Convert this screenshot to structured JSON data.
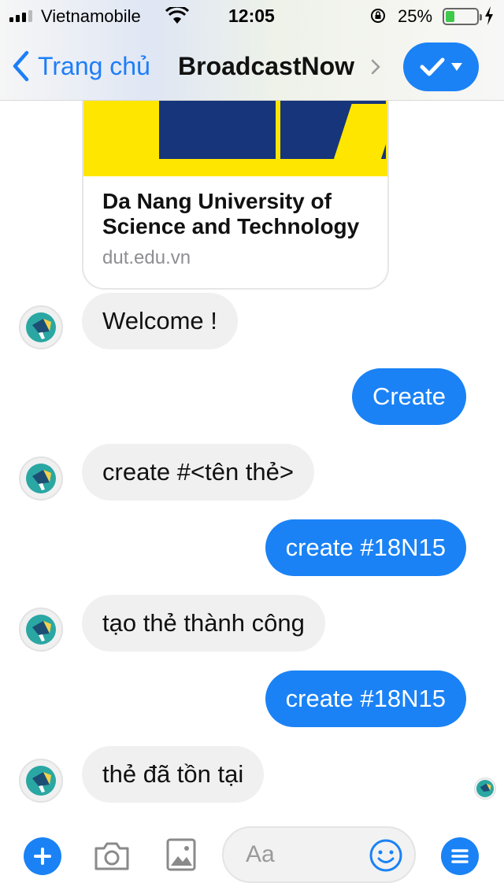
{
  "status_bar": {
    "carrier": "Vietnamobile",
    "time": "12:05",
    "battery_percent": "25%",
    "battery_level": 0.25,
    "icons": [
      "signal-icon",
      "wifi-icon",
      "orientation-lock-icon",
      "battery-icon",
      "charging-bolt-icon"
    ]
  },
  "nav": {
    "back_label": "Trang chủ",
    "title": "BroadcastNow",
    "action_icon": "checkmark-dropdown-icon"
  },
  "link_card": {
    "title": "Da Nang University of Science and Technology",
    "domain": "dut.edu.vn"
  },
  "messages": [
    {
      "side": "in",
      "text": "Welcome !"
    },
    {
      "side": "out",
      "text": "Create"
    },
    {
      "side": "in",
      "text": "create #<tên thẻ>"
    },
    {
      "side": "out",
      "text": "create #18N15"
    },
    {
      "side": "in",
      "text": "tạo thẻ thành công"
    },
    {
      "side": "out",
      "text": "create #18N15"
    },
    {
      "side": "in",
      "text": "thẻ đã tồn tại"
    }
  ],
  "composer": {
    "placeholder": "Aa",
    "value": "",
    "icons": [
      "plus-icon",
      "camera-icon",
      "image-icon",
      "emoji-icon",
      "menu-icon"
    ]
  },
  "colors": {
    "accent": "#1a82f5",
    "incoming_bubble": "#f1f0f0",
    "outgoing_bubble": "#1a82f5",
    "card_yellow": "#ffe600",
    "card_navy": "#17357a"
  }
}
